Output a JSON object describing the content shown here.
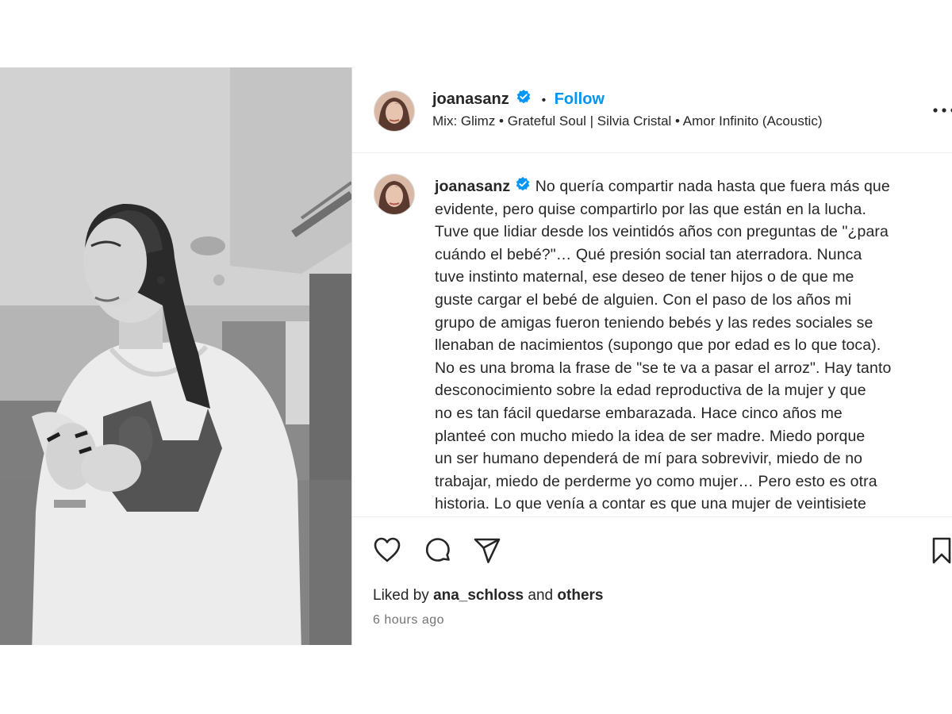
{
  "post": {
    "author": {
      "username": "joanasanz",
      "verified_icon": "verified-badge-icon",
      "separator": "•",
      "follow_label": "Follow"
    },
    "audio": "Mix: Glimz • Grateful Soul | Silvia Cristal • Amor Infinito (Acoustic)",
    "caption": {
      "username": "joanasanz",
      "lines": [
        "No quería compartir nada hasta que fuera más que",
        "evidente, pero quise compartirlo por las que están en la lucha.",
        "Tuve que lidiar desde los veintidós años con preguntas de \"¿para",
        "cuándo el bebé?\"… Qué presión social tan aterradora. Nunca",
        "tuve instinto maternal, ese deseo de tener hijos o de que me",
        "guste cargar el bebé de alguien. Con el paso de los años mi",
        "grupo de amigas fueron teniendo bebés y las redes sociales se",
        "llenaban de nacimientos (supongo que por edad es lo que toca).",
        "No es una broma la frase de \"se te va a pasar el arroz\". Hay tanto",
        "desconocimiento sobre la edad reproductiva de la mujer y que",
        "no es tan fácil quedarse embarazada. Hace cinco años me",
        "planteé con mucho miedo la idea de ser madre. Miedo porque",
        "un ser humano dependerá de mí para sobrevivir, miedo de no",
        "trabajar, miedo de perderme yo como mujer… Pero esto es otra",
        "historia. Lo que venía a contar es que una mujer de veintisiete"
      ]
    },
    "actions": {
      "like_icon": "heart-icon",
      "comment_icon": "comment-icon",
      "share_icon": "send-icon",
      "save_icon": "bookmark-icon",
      "more_icon": "more-options-icon"
    },
    "likes": {
      "prefix": "Liked by",
      "user": "ana_schloss",
      "conjunction": "and",
      "others": "others"
    },
    "timestamp": "6 hours ago",
    "colors": {
      "follow": "#0095f6",
      "verified": "#0095f6",
      "text": "#262626",
      "muted": "#737373"
    }
  }
}
